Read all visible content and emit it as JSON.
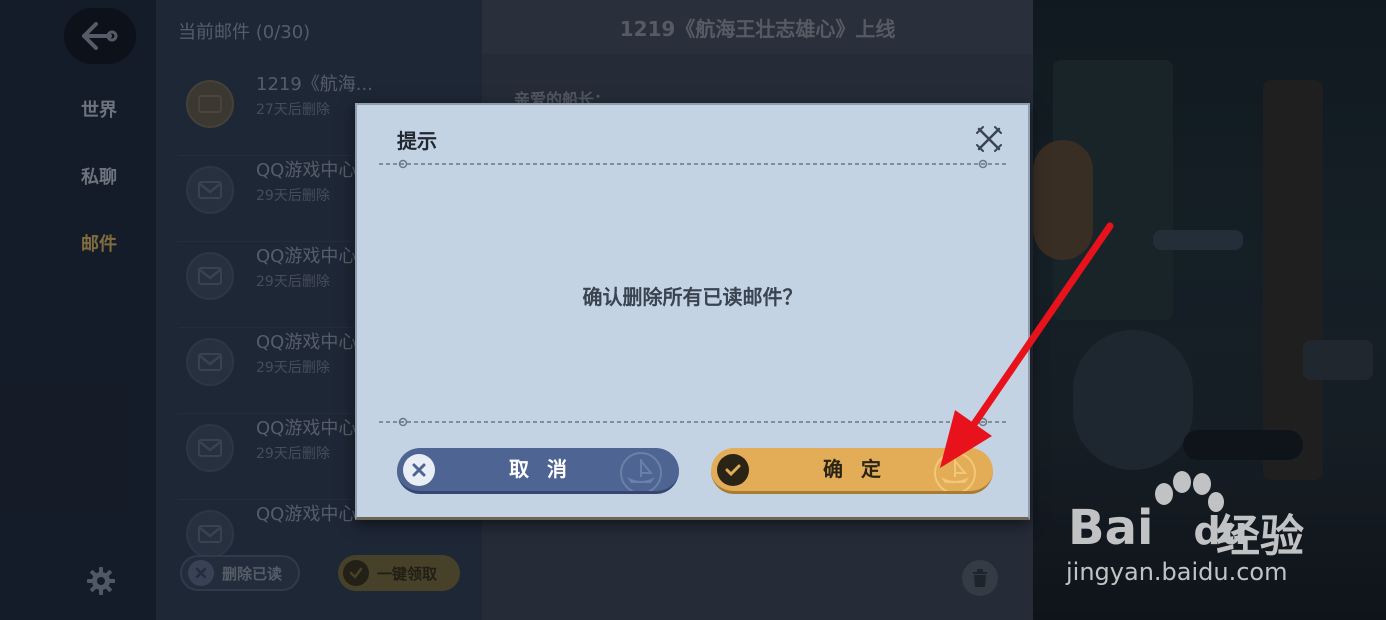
{
  "nav": {
    "items": [
      {
        "label": "世界",
        "active": false
      },
      {
        "label": "私聊",
        "active": false
      },
      {
        "label": "邮件",
        "active": true
      }
    ]
  },
  "mail_list": {
    "header": "当前邮件 (0/30)",
    "items": [
      {
        "title": "1219《航海...",
        "subtitle": "27天后删除"
      },
      {
        "title": "QQ游戏中心",
        "subtitle": "29天后删除"
      },
      {
        "title": "QQ游戏中心",
        "subtitle": "29天后删除"
      },
      {
        "title": "QQ游戏中心",
        "subtitle": "29天后删除"
      },
      {
        "title": "QQ游戏中心",
        "subtitle": "29天后删除"
      },
      {
        "title": "QQ游戏中心",
        "subtitle": ""
      }
    ],
    "delete_read_label": "删除已读",
    "claim_all_label": "一键领取"
  },
  "mail_content": {
    "title": "1219《航海王壮志雄心》上线",
    "greeting": "亲爱的船长："
  },
  "dialog": {
    "title": "提示",
    "message": "确认删除所有已读邮件？",
    "cancel_label": "取消",
    "confirm_label": "确定"
  },
  "watermark": {
    "brand": "Bai",
    "brand_suffix": "du",
    "product": "经验",
    "url": "jingyan.baidu.com"
  },
  "icons": {
    "back": "anchor-back-icon",
    "settings": "gear-icon",
    "close": "crossed-swords-close-icon",
    "cancel": "x-circle-icon",
    "confirm": "check-circle-icon",
    "trash": "trash-icon"
  },
  "colors": {
    "confirm_button": "#e3ad57",
    "cancel_button": "#4e6492",
    "dialog_bg": "#c4d3e3",
    "annotation_arrow": "#e8121c"
  }
}
